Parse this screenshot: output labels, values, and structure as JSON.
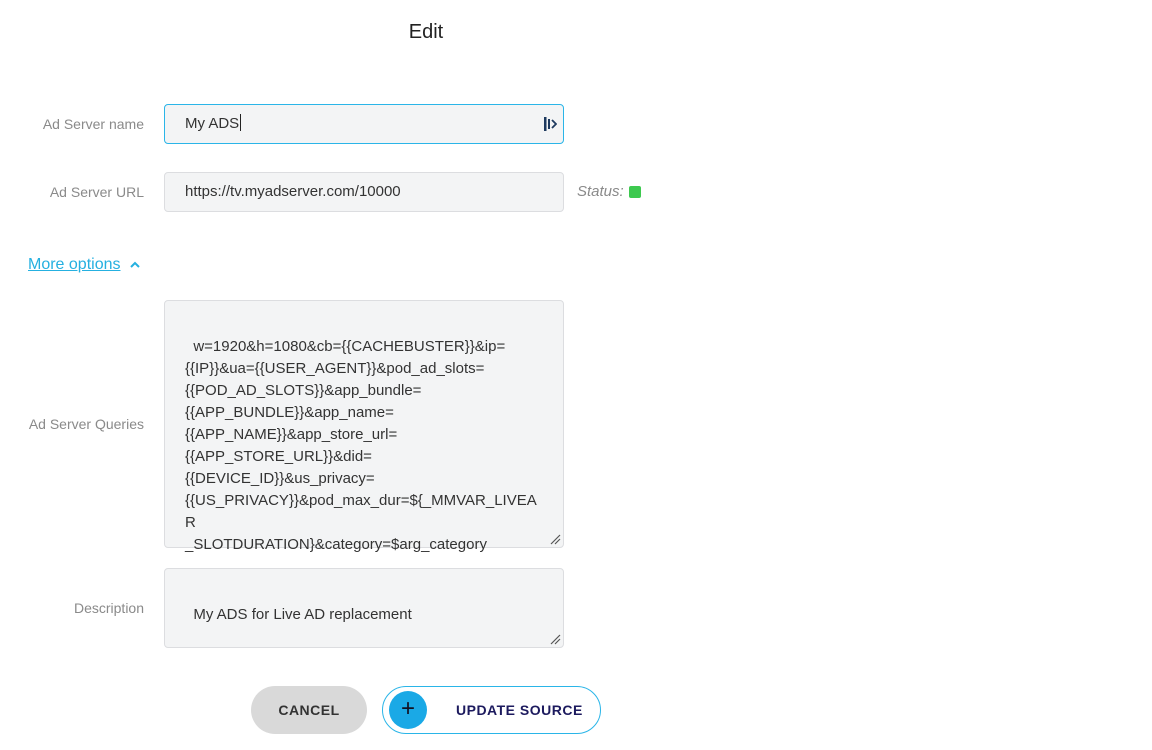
{
  "header": {
    "title": "Edit"
  },
  "form": {
    "name": {
      "label": "Ad Server name",
      "value": "My ADS"
    },
    "url": {
      "label": "Ad Server URL",
      "value": "https://tv.myadserver.com/10000"
    },
    "status": {
      "label": "Status:",
      "color": "#3dc94f"
    },
    "more_options": {
      "label": "More options",
      "icon": "chevron-up-icon"
    },
    "queries": {
      "label": "Ad Server Queries",
      "value": "w=1920&h=1080&cb={{CACHEBUSTER}}&ip=\n{{IP}}&ua={{USER_AGENT}}&pod_ad_slots=\n{{POD_AD_SLOTS}}&app_bundle=\n{{APP_BUNDLE}}&app_name=\n{{APP_NAME}}&app_store_url=\n{{APP_STORE_URL}}&did=\n{{DEVICE_ID}}&us_privacy=\n{{US_PRIVACY}}&pod_max_dur=${_MMVAR_LIVEAR\n_SLOTDURATION}&category=$arg_category"
    },
    "description": {
      "label": "Description",
      "value": "My ADS for Live AD replacement"
    }
  },
  "actions": {
    "cancel_label": "CANCEL",
    "update_label": "UPDATE SOURCE",
    "update_icon": "plus-icon"
  },
  "colors": {
    "accent": "#2ab5e8",
    "link": "#25b0e0",
    "button_text": "#1c1a5e"
  }
}
